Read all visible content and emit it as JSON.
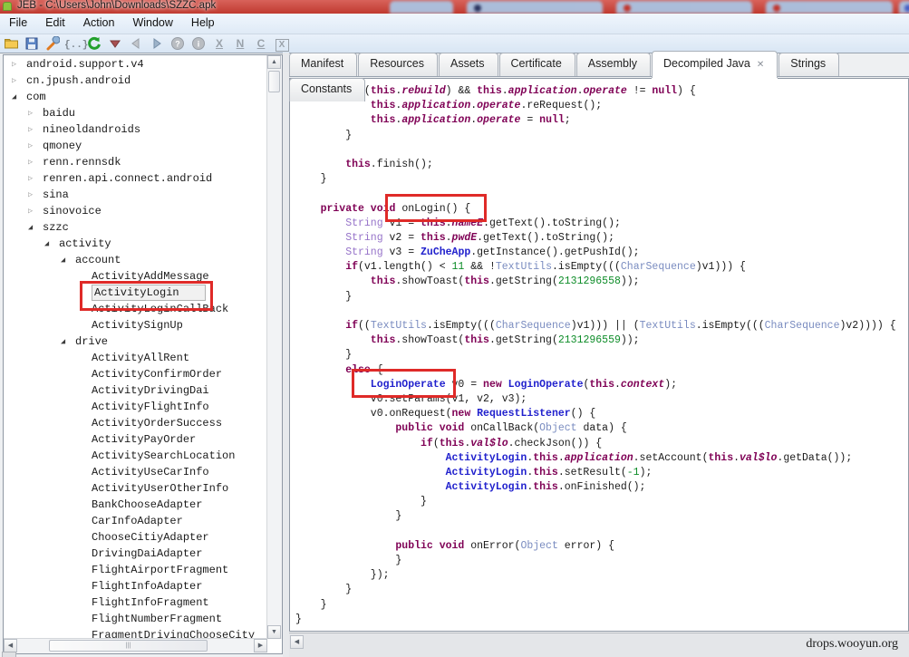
{
  "window": {
    "title": "JEB - C:\\Users\\John\\Downloads\\SZZC.apk",
    "watermark": "drops.wooyun.org"
  },
  "colors": {
    "titlebar_red": "#c8463c",
    "annotation_red": "#df2a28",
    "keyword": "#7f0055",
    "class_ref": "#2121cd",
    "weak_class": "#7a8cc0",
    "string_type": "#9673c9",
    "number": "#0d8c28"
  },
  "menu": {
    "items": [
      "File",
      "Edit",
      "Action",
      "Window",
      "Help"
    ]
  },
  "toolbar": {
    "buttons": [
      {
        "name": "open-file-button",
        "icon": "folder-icon"
      },
      {
        "name": "save-button",
        "icon": "floppy-icon"
      },
      {
        "name": "options-button",
        "icon": "wrench-icon"
      },
      {
        "name": "braces-button",
        "icon": "braces-icon"
      },
      {
        "name": "refresh-button",
        "icon": "refresh-icon"
      },
      {
        "name": "goto-down-button",
        "icon": "down-triangle-icon"
      },
      {
        "name": "back-button",
        "icon": "left-triangle-icon"
      },
      {
        "name": "forward-button",
        "icon": "right-triangle-icon"
      },
      {
        "name": "help-button",
        "icon": "question-icon"
      },
      {
        "name": "info-button",
        "icon": "info-icon"
      },
      {
        "name": "xref-button",
        "icon": "letter-x-icon"
      },
      {
        "name": "rename-button",
        "icon": "letter-n-icon"
      },
      {
        "name": "comment-button",
        "icon": "letter-c-icon"
      },
      {
        "name": "decompile-button",
        "icon": "boxed-x-icon"
      }
    ]
  },
  "tabs": {
    "close_glyph": "✕",
    "items": [
      {
        "label": "Manifest",
        "active": false,
        "closable": false
      },
      {
        "label": "Resources",
        "active": false,
        "closable": false
      },
      {
        "label": "Assets",
        "active": false,
        "closable": false
      },
      {
        "label": "Certificate",
        "active": false,
        "closable": false
      },
      {
        "label": "Assembly",
        "active": false,
        "closable": false
      },
      {
        "label": "Decompiled Java",
        "active": true,
        "closable": true
      },
      {
        "label": "Strings",
        "active": false,
        "closable": false
      },
      {
        "label": "Constants",
        "active": false,
        "closable": false
      }
    ]
  },
  "scrollbars": {
    "up": "▲",
    "down": "▼",
    "left": "◀",
    "right": "▶",
    "grip": "|||"
  },
  "tree": {
    "items": [
      {
        "label": "android.support.v4",
        "level": 0,
        "state": "collapsed"
      },
      {
        "label": "cn.jpush.android",
        "level": 0,
        "state": "collapsed"
      },
      {
        "label": "com",
        "level": 0,
        "state": "expanded"
      },
      {
        "label": "baidu",
        "level": 1,
        "state": "collapsed"
      },
      {
        "label": "nineoldandroids",
        "level": 1,
        "state": "collapsed"
      },
      {
        "label": "qmoney",
        "level": 1,
        "state": "collapsed"
      },
      {
        "label": "renn.rennsdk",
        "level": 1,
        "state": "collapsed"
      },
      {
        "label": "renren.api.connect.android",
        "level": 1,
        "state": "collapsed"
      },
      {
        "label": "sina",
        "level": 1,
        "state": "collapsed"
      },
      {
        "label": "sinovoice",
        "level": 1,
        "state": "collapsed"
      },
      {
        "label": "szzc",
        "level": 1,
        "state": "expanded"
      },
      {
        "label": "activity",
        "level": 2,
        "state": "expanded"
      },
      {
        "label": "account",
        "level": 3,
        "state": "expanded"
      },
      {
        "label": "ActivityAddMessage",
        "level": 4,
        "state": "leaf"
      },
      {
        "label": "ActivityLogin",
        "level": 4,
        "state": "leaf",
        "selected": true
      },
      {
        "label": "ActivityLoginCallBack",
        "level": 4,
        "state": "leaf"
      },
      {
        "label": "ActivitySignUp",
        "level": 4,
        "state": "leaf"
      },
      {
        "label": "drive",
        "level": 3,
        "state": "expanded"
      },
      {
        "label": "ActivityAllRent",
        "level": 4,
        "state": "leaf"
      },
      {
        "label": "ActivityConfirmOrder",
        "level": 4,
        "state": "leaf"
      },
      {
        "label": "ActivityDrivingDai",
        "level": 4,
        "state": "leaf"
      },
      {
        "label": "ActivityFlightInfo",
        "level": 4,
        "state": "leaf"
      },
      {
        "label": "ActivityOrderSuccess",
        "level": 4,
        "state": "leaf"
      },
      {
        "label": "ActivityPayOrder",
        "level": 4,
        "state": "leaf"
      },
      {
        "label": "ActivitySearchLocation",
        "level": 4,
        "state": "leaf"
      },
      {
        "label": "ActivityUseCarInfo",
        "level": 4,
        "state": "leaf"
      },
      {
        "label": "ActivityUserOtherInfo",
        "level": 4,
        "state": "leaf"
      },
      {
        "label": "BankChooseAdapter",
        "level": 4,
        "state": "leaf"
      },
      {
        "label": "CarInfoAdapter",
        "level": 4,
        "state": "leaf"
      },
      {
        "label": "ChooseCitiyAdapter",
        "level": 4,
        "state": "leaf"
      },
      {
        "label": "DrivingDaiAdapter",
        "level": 4,
        "state": "leaf"
      },
      {
        "label": "FlightAirportFragment",
        "level": 4,
        "state": "leaf"
      },
      {
        "label": "FlightInfoAdapter",
        "level": 4,
        "state": "leaf"
      },
      {
        "label": "FlightInfoFragment",
        "level": 4,
        "state": "leaf"
      },
      {
        "label": "FlightNumberFragment",
        "level": 4,
        "state": "leaf"
      },
      {
        "label": "FragmentDrivingChooseCity",
        "level": 4,
        "state": "leaf"
      }
    ]
  },
  "code": {
    "lines": [
      {
        "i": 8,
        "s": [
          [
            "k",
            "if"
          ],
          [
            "p",
            "(("
          ],
          [
            "t",
            "this"
          ],
          [
            "p",
            "."
          ],
          [
            "f",
            "rebuild"
          ],
          [
            "p",
            ") && "
          ],
          [
            "t",
            "this"
          ],
          [
            "p",
            "."
          ],
          [
            "f",
            "application"
          ],
          [
            "p",
            "."
          ],
          [
            "f",
            "operate"
          ],
          [
            "p",
            " != "
          ],
          [
            "k",
            "null"
          ],
          [
            "p",
            ") {"
          ]
        ]
      },
      {
        "i": 12,
        "s": [
          [
            "t",
            "this"
          ],
          [
            "p",
            "."
          ],
          [
            "f",
            "application"
          ],
          [
            "p",
            "."
          ],
          [
            "f",
            "operate"
          ],
          [
            "p",
            ".reRequest();"
          ]
        ]
      },
      {
        "i": 12,
        "s": [
          [
            "t",
            "this"
          ],
          [
            "p",
            "."
          ],
          [
            "f",
            "application"
          ],
          [
            "p",
            "."
          ],
          [
            "f",
            "operate"
          ],
          [
            "p",
            " = "
          ],
          [
            "k",
            "null"
          ],
          [
            "p",
            ";"
          ]
        ]
      },
      {
        "i": 8,
        "s": [
          [
            "p",
            "}"
          ]
        ]
      },
      {
        "i": 0,
        "s": []
      },
      {
        "i": 8,
        "s": [
          [
            "t",
            "this"
          ],
          [
            "p",
            ".finish();"
          ]
        ]
      },
      {
        "i": 4,
        "s": [
          [
            "p",
            "}"
          ]
        ]
      },
      {
        "i": 0,
        "s": []
      },
      {
        "i": 4,
        "s": [
          [
            "k",
            "private void"
          ],
          [
            "p",
            " onLogin() {"
          ]
        ]
      },
      {
        "i": 8,
        "s": [
          [
            "s",
            "String"
          ],
          [
            "p",
            " v1 = "
          ],
          [
            "t",
            "this"
          ],
          [
            "p",
            "."
          ],
          [
            "f",
            "nameE"
          ],
          [
            "p",
            ".getText().toString();"
          ]
        ]
      },
      {
        "i": 8,
        "s": [
          [
            "s",
            "String"
          ],
          [
            "p",
            " v2 = "
          ],
          [
            "t",
            "this"
          ],
          [
            "p",
            "."
          ],
          [
            "f",
            "pwdE"
          ],
          [
            "p",
            ".getText().toString();"
          ]
        ]
      },
      {
        "i": 8,
        "s": [
          [
            "s",
            "String"
          ],
          [
            "p",
            " v3 = "
          ],
          [
            "c",
            "ZuCheApp"
          ],
          [
            "p",
            ".getInstance().getPushId();"
          ]
        ]
      },
      {
        "i": 8,
        "s": [
          [
            "k",
            "if"
          ],
          [
            "p",
            "(v1.length() < "
          ],
          [
            "n",
            "11"
          ],
          [
            "p",
            " && !"
          ],
          [
            "w",
            "TextUtils"
          ],
          [
            "p",
            ".isEmpty((("
          ],
          [
            "w",
            "CharSequence"
          ],
          [
            "p",
            ")v1))) {"
          ]
        ]
      },
      {
        "i": 12,
        "s": [
          [
            "t",
            "this"
          ],
          [
            "p",
            ".showToast("
          ],
          [
            "t",
            "this"
          ],
          [
            "p",
            ".getString("
          ],
          [
            "n",
            "2131296558"
          ],
          [
            "p",
            "));"
          ]
        ]
      },
      {
        "i": 8,
        "s": [
          [
            "p",
            "}"
          ]
        ]
      },
      {
        "i": 0,
        "s": []
      },
      {
        "i": 8,
        "s": [
          [
            "k",
            "if"
          ],
          [
            "p",
            "(("
          ],
          [
            "w",
            "TextUtils"
          ],
          [
            "p",
            ".isEmpty((("
          ],
          [
            "w",
            "CharSequence"
          ],
          [
            "p",
            ")v1))) || ("
          ],
          [
            "w",
            "TextUtils"
          ],
          [
            "p",
            ".isEmpty((("
          ],
          [
            "w",
            "CharSequence"
          ],
          [
            "p",
            ")v2)))) {"
          ]
        ]
      },
      {
        "i": 12,
        "s": [
          [
            "t",
            "this"
          ],
          [
            "p",
            ".showToast("
          ],
          [
            "t",
            "this"
          ],
          [
            "p",
            ".getString("
          ],
          [
            "n",
            "2131296559"
          ],
          [
            "p",
            "));"
          ]
        ]
      },
      {
        "i": 8,
        "s": [
          [
            "p",
            "}"
          ]
        ]
      },
      {
        "i": 8,
        "s": [
          [
            "k",
            "else"
          ],
          [
            "p",
            " {"
          ]
        ]
      },
      {
        "i": 12,
        "s": [
          [
            "c",
            "LoginOperate"
          ],
          [
            "p",
            " v0 = "
          ],
          [
            "k",
            "new"
          ],
          [
            "p",
            " "
          ],
          [
            "c",
            "LoginOperate"
          ],
          [
            "p",
            "("
          ],
          [
            "t",
            "this"
          ],
          [
            "p",
            "."
          ],
          [
            "f",
            "context"
          ],
          [
            "p",
            ");"
          ]
        ]
      },
      {
        "i": 12,
        "s": [
          [
            "p",
            "v0.setParams(v1, v2, v3);"
          ]
        ]
      },
      {
        "i": 12,
        "s": [
          [
            "p",
            "v0.onRequest("
          ],
          [
            "k",
            "new"
          ],
          [
            "p",
            " "
          ],
          [
            "c",
            "RequestListener"
          ],
          [
            "p",
            "() {"
          ]
        ]
      },
      {
        "i": 16,
        "s": [
          [
            "k",
            "public void"
          ],
          [
            "p",
            " onCallBack("
          ],
          [
            "w",
            "Object"
          ],
          [
            "p",
            " data) {"
          ]
        ]
      },
      {
        "i": 20,
        "s": [
          [
            "k",
            "if"
          ],
          [
            "p",
            "("
          ],
          [
            "t",
            "this"
          ],
          [
            "p",
            "."
          ],
          [
            "f",
            "val$lo"
          ],
          [
            "p",
            ".checkJson()) {"
          ]
        ]
      },
      {
        "i": 24,
        "s": [
          [
            "c",
            "ActivityLogin"
          ],
          [
            "p",
            "."
          ],
          [
            "t",
            "this"
          ],
          [
            "p",
            "."
          ],
          [
            "f",
            "application"
          ],
          [
            "p",
            ".setAccount("
          ],
          [
            "t",
            "this"
          ],
          [
            "p",
            "."
          ],
          [
            "f",
            "val$lo"
          ],
          [
            "p",
            ".getData());"
          ]
        ]
      },
      {
        "i": 24,
        "s": [
          [
            "c",
            "ActivityLogin"
          ],
          [
            "p",
            "."
          ],
          [
            "t",
            "this"
          ],
          [
            "p",
            ".setResult("
          ],
          [
            "n",
            "-1"
          ],
          [
            "p",
            ");"
          ]
        ]
      },
      {
        "i": 24,
        "s": [
          [
            "c",
            "ActivityLogin"
          ],
          [
            "p",
            "."
          ],
          [
            "t",
            "this"
          ],
          [
            "p",
            ".onFinished();"
          ]
        ]
      },
      {
        "i": 20,
        "s": [
          [
            "p",
            "}"
          ]
        ]
      },
      {
        "i": 16,
        "s": [
          [
            "p",
            "}"
          ]
        ]
      },
      {
        "i": 0,
        "s": []
      },
      {
        "i": 16,
        "s": [
          [
            "k",
            "public void"
          ],
          [
            "p",
            " onError("
          ],
          [
            "w",
            "Object"
          ],
          [
            "p",
            " error) {"
          ]
        ]
      },
      {
        "i": 16,
        "s": [
          [
            "p",
            "}"
          ]
        ]
      },
      {
        "i": 12,
        "s": [
          [
            "p",
            "});"
          ]
        ]
      },
      {
        "i": 8,
        "s": [
          [
            "p",
            "}"
          ]
        ]
      },
      {
        "i": 4,
        "s": [
          [
            "p",
            "}"
          ]
        ]
      },
      {
        "i": 0,
        "s": [
          [
            "p",
            "}"
          ]
        ]
      }
    ]
  }
}
